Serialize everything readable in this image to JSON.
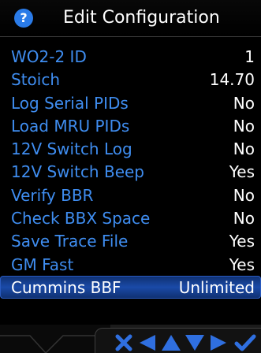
{
  "dialog": {
    "title": "Edit Configuration",
    "help_icon": "?"
  },
  "rows": [
    {
      "label": "WO2-2 ID",
      "value": "1"
    },
    {
      "label": "Stoich",
      "value": "14.70"
    },
    {
      "label": "Log Serial PIDs",
      "value": "No"
    },
    {
      "label": "Load MRU PIDs",
      "value": "No"
    },
    {
      "label": "12V Switch Log",
      "value": "No"
    },
    {
      "label": "12V Switch Beep",
      "value": "Yes"
    },
    {
      "label": "Verify BBR",
      "value": "No"
    },
    {
      "label": "Check BBX Space",
      "value": "No"
    },
    {
      "label": "Save Trace File",
      "value": "Yes"
    },
    {
      "label": "GM Fast",
      "value": "Yes"
    },
    {
      "label": "Cummins BBF",
      "value": "Unlimited",
      "selected": true
    }
  ],
  "toolbar": {
    "buttons": [
      "close-icon",
      "left-arrow-icon",
      "up-arrow-icon",
      "down-arrow-icon",
      "right-arrow-icon",
      "checkmark-icon"
    ]
  },
  "colors": {
    "label": "#3f8df0",
    "value": "#ffffff",
    "selected_row": "#1a4aa8",
    "toolbar_icon": "#2f6fe0"
  }
}
